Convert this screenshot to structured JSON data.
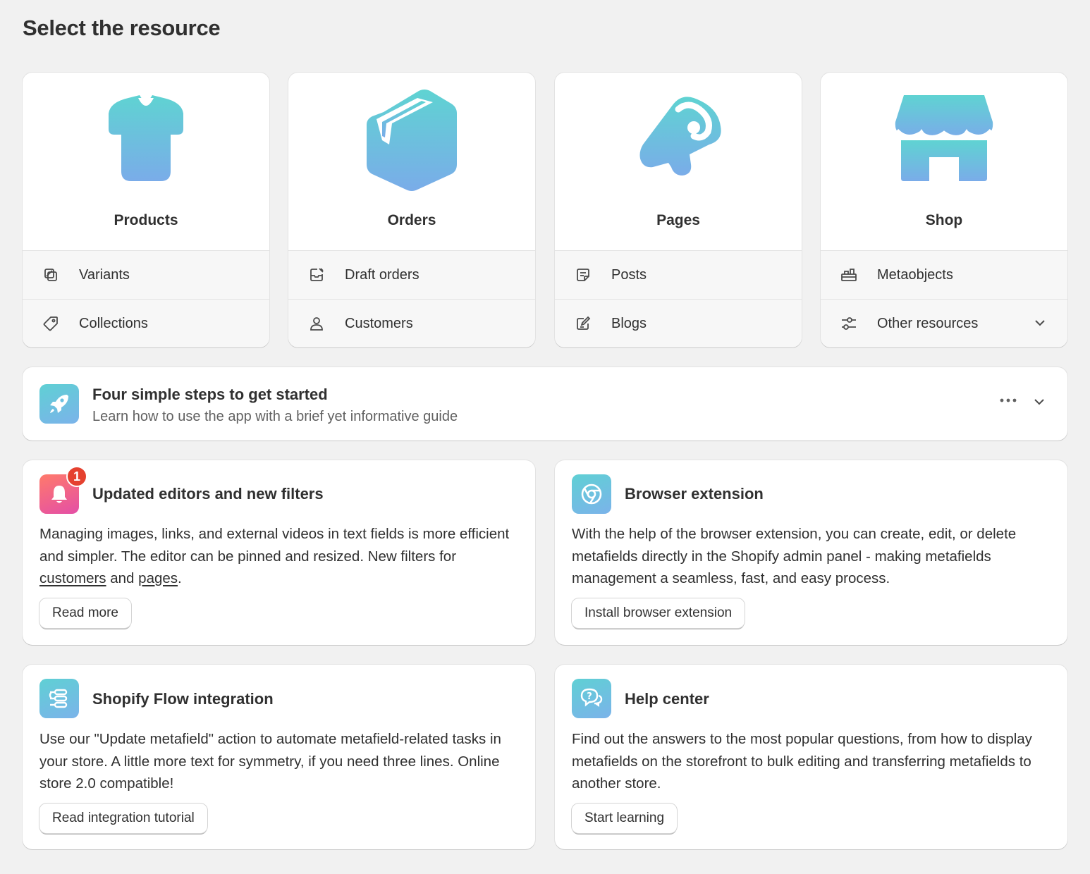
{
  "page_title": "Select the resource",
  "resources": [
    {
      "title": "Products",
      "icon": "tshirt-icon",
      "links": [
        {
          "label": "Variants",
          "icon": "variants-icon"
        },
        {
          "label": "Collections",
          "icon": "tag-icon"
        }
      ]
    },
    {
      "title": "Orders",
      "icon": "box-icon",
      "links": [
        {
          "label": "Draft orders",
          "icon": "draft-edit-icon"
        },
        {
          "label": "Customers",
          "icon": "person-icon"
        }
      ]
    },
    {
      "title": "Pages",
      "icon": "megaphone-icon",
      "links": [
        {
          "label": "Posts",
          "icon": "note-icon"
        },
        {
          "label": "Blogs",
          "icon": "edit-icon"
        }
      ]
    },
    {
      "title": "Shop",
      "icon": "storefront-icon",
      "links": [
        {
          "label": "Metaobjects",
          "icon": "metaobjects-icon"
        },
        {
          "label": "Other resources",
          "icon": "sliders-icon"
        }
      ]
    }
  ],
  "steps": {
    "title": "Four simple steps to get started",
    "subtitle": "Learn how to use the app with a brief yet informative guide"
  },
  "news": {
    "title": "Updated editors and new filters",
    "badge": "1",
    "body_before": "Managing images, links, and external videos in text fields is more efficient and simpler. The editor can be pinned and resized. New filters for ",
    "link_customers": "customers",
    "body_middle": " and ",
    "link_pages": "pages",
    "body_after": ".",
    "button": "Read more"
  },
  "extension": {
    "title": "Browser extension",
    "body": "With the help of the browser extension, you can create, edit, or delete metafields directly in the Shopify admin panel - making metafields management a seamless, fast, and easy process.",
    "button": "Install browser extension"
  },
  "flow": {
    "title": "Shopify Flow integration",
    "body": "Use our \"Update metafield\" action to automate metafield-related tasks in your store. A little more text for symmetry, if you need three lines. Online store 2.0 compatible!",
    "button": "Read integration tutorial"
  },
  "help": {
    "title": "Help center",
    "body": "Find out the answers to the most popular questions, from how to display metafields on the storefront to bulk editing and transferring metafields to another store.",
    "button": "Start learning"
  },
  "colors": {
    "gradient_start": "#5fd0d4",
    "gradient_end": "#7bb3ea",
    "badge": "#e5412f"
  }
}
